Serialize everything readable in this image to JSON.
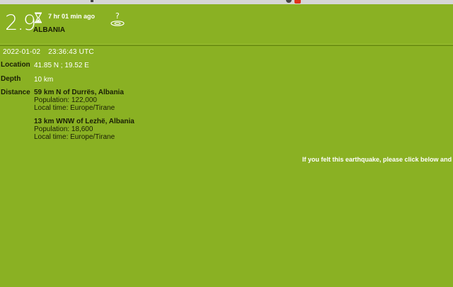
{
  "header": {
    "magnitude": "2.9",
    "time_ago": "7 hr  01 min ago",
    "region": "ALBANIA"
  },
  "details": {
    "date": "2022-01-02",
    "time": "23:36:43 UTC",
    "location_label": "Location",
    "location_value": "41.85 N ; 19.52 E",
    "depth_label": "Depth",
    "depth_value": "10 km",
    "distance_label": "Distance",
    "places": [
      {
        "name": "59 km N of Durrës, Albania",
        "population": "Population: 122,000",
        "local_time": "Local time: Europe/Tirane"
      },
      {
        "name": "13 km WNW of Lezhë, Albania",
        "population": "Population: 18,600",
        "local_time": "Local time: Europe/Tirane"
      }
    ]
  },
  "felt_message": "If you felt this earthquake, please click below and",
  "icons": {
    "hourglass": "hourglass-icon",
    "felt": "felt-report-icon"
  },
  "colors": {
    "background": "#8ab123",
    "accent_red": "#e0341d"
  }
}
